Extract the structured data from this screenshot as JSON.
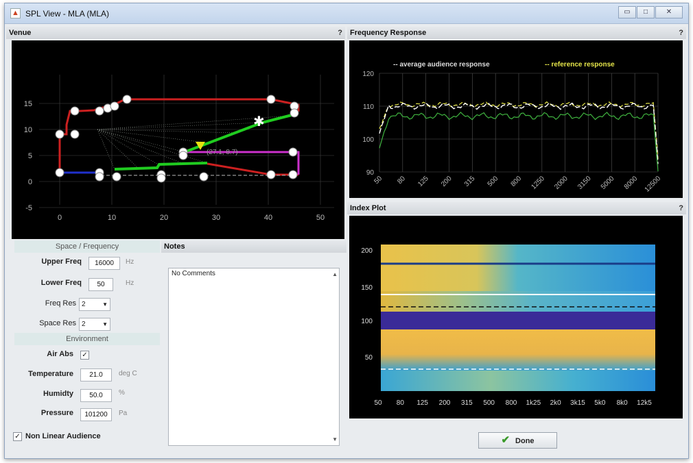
{
  "window": {
    "title": "SPL View - MLA (MLA)",
    "minimize": "▭",
    "maximize": "□",
    "close": "✕"
  },
  "venue": {
    "title": "Venue",
    "help": "?",
    "x_ticks": [
      "0",
      "10",
      "20",
      "30",
      "40",
      "50"
    ],
    "y_ticks": [
      "15",
      "10",
      "5",
      "0",
      "-5"
    ],
    "annotation": "(27.1, 8.7)"
  },
  "frequency_response": {
    "title": "Frequency Response",
    "help": "?",
    "legend": [
      "average audience response",
      "reference response"
    ],
    "y_ticks": [
      "120",
      "110",
      "100",
      "90"
    ],
    "x_ticks": [
      "50",
      "80",
      "125",
      "200",
      "315",
      "500",
      "800",
      "1250",
      "2000",
      "3150",
      "5000",
      "8000",
      "12500"
    ]
  },
  "index_plot": {
    "title": "Index Plot",
    "help": "?",
    "y_ticks": [
      "200",
      "150",
      "100",
      "50"
    ],
    "x_ticks": [
      "50",
      "80",
      "125",
      "200",
      "315",
      "500",
      "800",
      "1k25",
      "2k0",
      "3k15",
      "5k0",
      "8k0",
      "12k5"
    ]
  },
  "space_frequency": {
    "header": "Space / Frequency",
    "upper_freq": {
      "label": "Upper Freq",
      "value": "16000",
      "unit": "Hz"
    },
    "lower_freq": {
      "label": "Lower Freq",
      "value": "50",
      "unit": "Hz"
    },
    "freq_res": {
      "label": "Freq Res",
      "value": "2"
    },
    "space_res": {
      "label": "Space Res",
      "value": "2"
    }
  },
  "environment": {
    "header": "Environment",
    "air_abs": {
      "label": "Air Abs",
      "checked": "✓"
    },
    "temperature": {
      "label": "Temperature",
      "value": "21.0",
      "unit": "deg C"
    },
    "humidity": {
      "label": "Humidty",
      "value": "50.0",
      "unit": "%"
    },
    "pressure": {
      "label": "Pressure",
      "value": "101200",
      "unit": "Pa"
    }
  },
  "non_linear": {
    "label": "Non Linear Audience",
    "checked": "✓"
  },
  "notes": {
    "title": "Notes",
    "text": "No Comments"
  },
  "done": {
    "label": "Done"
  },
  "colors": {
    "plot_bg": "#000000",
    "average": "#ffffff",
    "reference": "#e6e64a",
    "response": "#3fb23f"
  }
}
